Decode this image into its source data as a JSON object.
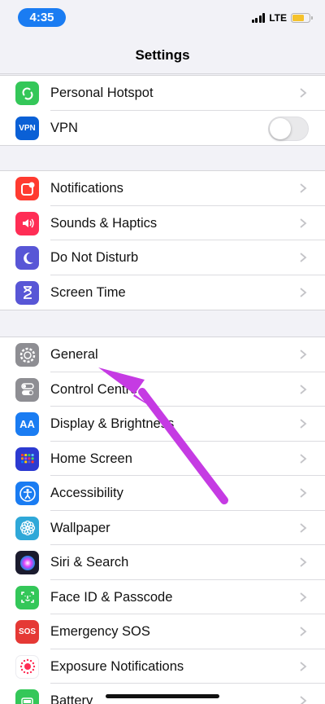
{
  "status_bar": {
    "time": "4:35",
    "network": "LTE",
    "battery_level": 0.7,
    "battery_color": "#f5c22c"
  },
  "nav": {
    "title": "Settings"
  },
  "groups": [
    {
      "rows": [
        {
          "label": "Personal Hotspot",
          "icon": "personal-hotspot-icon",
          "color": "#34c759",
          "accessory": "chevron"
        },
        {
          "label": "VPN",
          "icon": "vpn-icon",
          "icon_text": "VPN",
          "color": "#0a60d6",
          "accessory": "toggle",
          "toggle_on": false
        }
      ]
    },
    {
      "rows": [
        {
          "label": "Notifications",
          "icon": "notifications-icon",
          "color": "#ff3b30",
          "accessory": "chevron"
        },
        {
          "label": "Sounds & Haptics",
          "icon": "sounds-icon",
          "color": "#ff2d55",
          "accessory": "chevron"
        },
        {
          "label": "Do Not Disturb",
          "icon": "moon-icon",
          "color": "#5856d6",
          "accessory": "chevron"
        },
        {
          "label": "Screen Time",
          "icon": "hourglass-icon",
          "color": "#5856d6",
          "accessory": "chevron"
        }
      ]
    },
    {
      "rows": [
        {
          "label": "General",
          "icon": "gear-icon",
          "color": "#8e8e93",
          "accessory": "chevron"
        },
        {
          "label": "Control Centre",
          "icon": "control-centre-icon",
          "color": "#8e8e93",
          "accessory": "chevron"
        },
        {
          "label": "Display & Brightness",
          "icon": "display-brightness-icon",
          "icon_text": "AA",
          "color": "#1a7cf2",
          "accessory": "chevron"
        },
        {
          "label": "Home Screen",
          "icon": "home-screen-icon",
          "color": "#2c3ad1",
          "accessory": "chevron"
        },
        {
          "label": "Accessibility",
          "icon": "accessibility-icon",
          "color": "#1a7cf2",
          "accessory": "chevron"
        },
        {
          "label": "Wallpaper",
          "icon": "wallpaper-icon",
          "color": "#2fa8d8",
          "accessory": "chevron"
        },
        {
          "label": "Siri & Search",
          "icon": "siri-icon",
          "color": "#1b1b2e",
          "accessory": "chevron"
        },
        {
          "label": "Face ID & Passcode",
          "icon": "face-id-icon",
          "color": "#34c759",
          "accessory": "chevron"
        },
        {
          "label": "Emergency SOS",
          "icon": "sos-icon",
          "icon_text": "SOS",
          "color": "#e53935",
          "accessory": "chevron"
        },
        {
          "label": "Exposure Notifications",
          "icon": "exposure-icon",
          "color": "#ffffff",
          "accessory": "chevron"
        },
        {
          "label": "Battery",
          "icon": "battery-icon",
          "color": "#34c759",
          "accessory": "chevron"
        }
      ]
    }
  ],
  "annotation": {
    "arrow_color": "#c53be3"
  }
}
